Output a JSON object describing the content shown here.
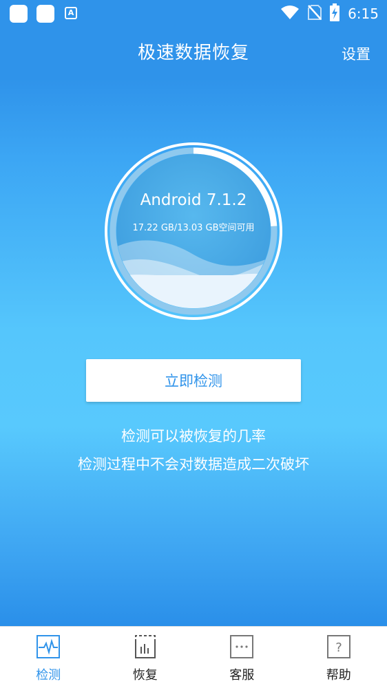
{
  "status_bar": {
    "time": "6:15",
    "icons": [
      "notification-square-icon",
      "notification-square-icon",
      "translate-a-icon",
      "wifi-icon",
      "no-sim-icon",
      "battery-charging-icon"
    ]
  },
  "header": {
    "title": "极速数据恢复",
    "settings_label": "设置"
  },
  "device": {
    "os": "Android 7.1.2",
    "storage": "17.22 GB/13.03 GB空间可用",
    "storage_used_fraction": 0.24
  },
  "main": {
    "detect_button_label": "立即检测",
    "info_lines": [
      "检测可以被恢复的几率",
      "检测过程中不会对数据造成二次破坏"
    ]
  },
  "tabs": [
    {
      "label": "检测",
      "icon": "pulse-monitor-icon",
      "active": true
    },
    {
      "label": "恢复",
      "icon": "recover-chart-icon",
      "active": false
    },
    {
      "label": "客服",
      "icon": "chat-dots-icon",
      "active": false
    },
    {
      "label": "帮助",
      "icon": "help-question-icon",
      "active": false
    }
  ],
  "colors": {
    "primary": "#2f93ea",
    "background_light": "#58c9fd",
    "tab_inactive": "#222222"
  }
}
